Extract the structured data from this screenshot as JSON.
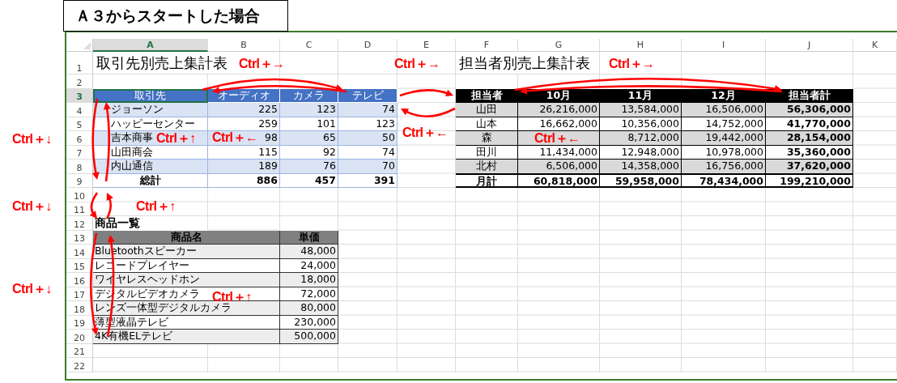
{
  "callout": {
    "title": "Ａ３からスタートした場合"
  },
  "sheet": {
    "columns": [
      {
        "label": "A",
        "selected": true
      },
      {
        "label": "B",
        "selected": false
      },
      {
        "label": "C",
        "selected": false
      },
      {
        "label": "D",
        "selected": false
      },
      {
        "label": "E",
        "selected": false
      },
      {
        "label": "F",
        "selected": false
      },
      {
        "label": "G",
        "selected": false
      },
      {
        "label": "H",
        "selected": false
      },
      {
        "label": "I",
        "selected": false
      },
      {
        "label": "J",
        "selected": false
      },
      {
        "label": "K",
        "selected": false
      }
    ],
    "rows": [
      {
        "label": "1",
        "selected": false
      },
      {
        "label": "2",
        "selected": false
      },
      {
        "label": "3",
        "selected": true
      },
      {
        "label": "4",
        "selected": false
      },
      {
        "label": "5",
        "selected": false
      },
      {
        "label": "6",
        "selected": false
      },
      {
        "label": "7",
        "selected": false
      },
      {
        "label": "8",
        "selected": false
      },
      {
        "label": "9",
        "selected": false
      },
      {
        "label": "10",
        "selected": false
      },
      {
        "label": "11",
        "selected": false
      },
      {
        "label": "12",
        "selected": false
      },
      {
        "label": "13",
        "selected": false
      },
      {
        "label": "14",
        "selected": false
      },
      {
        "label": "15",
        "selected": false
      },
      {
        "label": "16",
        "selected": false
      },
      {
        "label": "17",
        "selected": false
      },
      {
        "label": "18",
        "selected": false
      },
      {
        "label": "19",
        "selected": false
      },
      {
        "label": "20",
        "selected": false
      },
      {
        "label": "21",
        "selected": false
      },
      {
        "label": "22",
        "selected": false
      }
    ]
  },
  "client_table": {
    "title": "取引先別売上集計表",
    "columns": [
      "取引先",
      "オーディオ",
      "カメラ",
      "テレビ"
    ],
    "rows": [
      [
        "ジョーソン",
        "225",
        "123",
        "74"
      ],
      [
        "ハッピーセンター",
        "259",
        "101",
        "123"
      ],
      [
        "吉本商事",
        "98",
        "65",
        "50"
      ],
      [
        "山田商会",
        "115",
        "92",
        "74"
      ],
      [
        "内山通信",
        "189",
        "76",
        "70"
      ]
    ],
    "total": [
      "総計",
      "886",
      "457",
      "391"
    ]
  },
  "staff_table": {
    "title": "担当者別売上集計表",
    "columns": [
      "担当者",
      "10月",
      "11月",
      "12月",
      "担当者計"
    ],
    "rows": [
      [
        "山田",
        "26,216,000",
        "13,584,000",
        "16,506,000",
        "56,306,000"
      ],
      [
        "山本",
        "16,662,000",
        "10,356,000",
        "14,752,000",
        "41,770,000"
      ],
      [
        "森",
        null,
        "8,712,000",
        "19,442,000",
        "28,154,000"
      ],
      [
        "田川",
        "11,434,000",
        "12,948,000",
        "10,978,000",
        "35,360,000"
      ],
      [
        "北村",
        "6,506,000",
        "14,358,000",
        "16,756,000",
        "37,620,000"
      ]
    ],
    "total": [
      "月計",
      "60,818,000",
      "59,958,000",
      "78,434,000",
      "199,210,000"
    ]
  },
  "product_table": {
    "title": "商品一覧",
    "columns": [
      "商品名",
      "単価"
    ],
    "rows": [
      [
        "Bluetoothスピーカー",
        "48,000"
      ],
      [
        "レコードプレイヤー",
        "24,000"
      ],
      [
        "ワイヤレスヘッドホン",
        "18,000"
      ],
      [
        "デジタルビデオカメラ",
        "72,000"
      ],
      [
        "レンズ一体型デジタルカメラ",
        "80,000"
      ],
      [
        "薄型液晶テレビ",
        "230,000"
      ],
      [
        "4K有機ELテレビ",
        "500,000"
      ]
    ]
  },
  "annotations": [
    {
      "text": "Ctrl＋→"
    },
    {
      "text": "Ctrl＋→"
    },
    {
      "text": "Ctrl＋→"
    },
    {
      "text": "Ctrl＋↓"
    },
    {
      "text": "Ctrl＋↑"
    },
    {
      "text": "Ctrl＋←"
    },
    {
      "text": "Ctrl＋←"
    },
    {
      "text": "Ctrl＋←"
    },
    {
      "text": "Ctrl＋↓"
    },
    {
      "text": "Ctrl＋↑"
    },
    {
      "text": "Ctrl＋↓"
    },
    {
      "text": "Ctrl＋↑"
    }
  ]
}
